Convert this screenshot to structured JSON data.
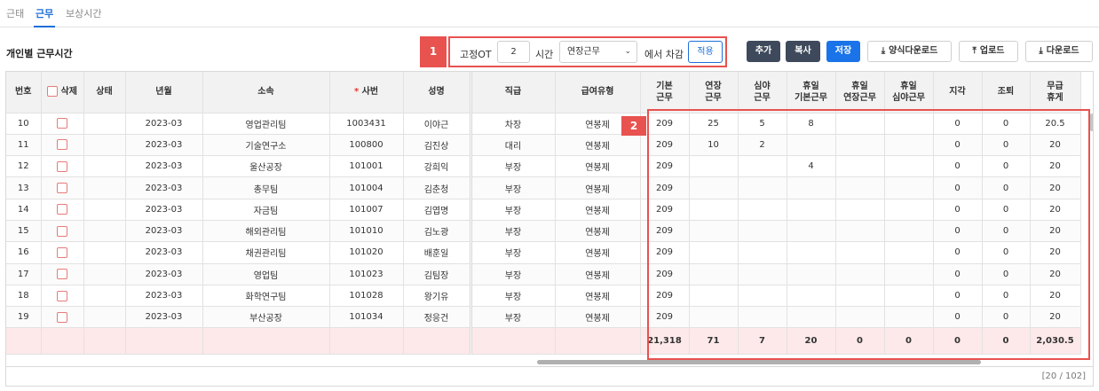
{
  "tabs": [
    {
      "label": "근태",
      "active": false
    },
    {
      "label": "근무",
      "active": true
    },
    {
      "label": "보상시간",
      "active": false
    }
  ],
  "page_title": "개인별 근무시간",
  "ot_control": {
    "marker": "1",
    "label_fixed": "고정OT",
    "value": "2",
    "label_hours": "시간",
    "select_value": "연장근무",
    "label_deduct": "에서 차감",
    "apply_label": "적용"
  },
  "toolbar": {
    "add_label": "추가",
    "copy_label": "복사",
    "save_label": "저장",
    "template_download_label": "양식다운로드",
    "upload_label": "업로드",
    "download_label": "다운로드"
  },
  "grid": {
    "highlight_marker": "2",
    "headers": {
      "no": "번호",
      "delete": "삭제",
      "status": "상태",
      "year_month": "년월",
      "department": "소속",
      "emp_no": "사번",
      "name": "성명",
      "rank": "직급",
      "pay_type": "급여유형",
      "base_work": "기본\n근무",
      "overtime": "연장\n근무",
      "night": "심야\n근무",
      "holiday_base": "휴일\n기본근무",
      "holiday_overtime": "휴일\n연장근무",
      "holiday_night": "휴일\n심야근무",
      "late": "지각",
      "early_leave": "조퇴",
      "unpaid_leave": "무급\n휴게"
    },
    "rows": [
      {
        "no": "10",
        "status": "",
        "ym": "2023-03",
        "dept": "영업관리팀",
        "emp": "1003431",
        "name": "이야근",
        "rank": "차장",
        "pay": "연봉제",
        "base": "209",
        "ot": "25",
        "night": "5",
        "hbase": "8",
        "hot": "",
        "hnight": "",
        "late": "0",
        "early": "0",
        "unpaid": "20.5"
      },
      {
        "no": "11",
        "status": "",
        "ym": "2023-03",
        "dept": "기술연구소",
        "emp": "100800",
        "name": "김진상",
        "rank": "대리",
        "pay": "연봉제",
        "base": "209",
        "ot": "10",
        "night": "2",
        "hbase": "",
        "hot": "",
        "hnight": "",
        "late": "0",
        "early": "0",
        "unpaid": "20"
      },
      {
        "no": "12",
        "status": "",
        "ym": "2023-03",
        "dept": "울산공장",
        "emp": "101001",
        "name": "강희익",
        "rank": "부장",
        "pay": "연봉제",
        "base": "209",
        "ot": "",
        "night": "",
        "hbase": "4",
        "hot": "",
        "hnight": "",
        "late": "0",
        "early": "0",
        "unpaid": "20"
      },
      {
        "no": "13",
        "status": "",
        "ym": "2023-03",
        "dept": "총무팀",
        "emp": "101004",
        "name": "김춘청",
        "rank": "부장",
        "pay": "연봉제",
        "base": "209",
        "ot": "",
        "night": "",
        "hbase": "",
        "hot": "",
        "hnight": "",
        "late": "0",
        "early": "0",
        "unpaid": "20"
      },
      {
        "no": "14",
        "status": "",
        "ym": "2023-03",
        "dept": "자금팀",
        "emp": "101007",
        "name": "김엽명",
        "rank": "부장",
        "pay": "연봉제",
        "base": "209",
        "ot": "",
        "night": "",
        "hbase": "",
        "hot": "",
        "hnight": "",
        "late": "0",
        "early": "0",
        "unpaid": "20"
      },
      {
        "no": "15",
        "status": "",
        "ym": "2023-03",
        "dept": "해외관리팀",
        "emp": "101010",
        "name": "김노광",
        "rank": "부장",
        "pay": "연봉제",
        "base": "209",
        "ot": "",
        "night": "",
        "hbase": "",
        "hot": "",
        "hnight": "",
        "late": "0",
        "early": "0",
        "unpaid": "20"
      },
      {
        "no": "16",
        "status": "",
        "ym": "2023-03",
        "dept": "채권관리팀",
        "emp": "101020",
        "name": "배훈일",
        "rank": "부장",
        "pay": "연봉제",
        "base": "209",
        "ot": "",
        "night": "",
        "hbase": "",
        "hot": "",
        "hnight": "",
        "late": "0",
        "early": "0",
        "unpaid": "20"
      },
      {
        "no": "17",
        "status": "",
        "ym": "2023-03",
        "dept": "영업팀",
        "emp": "101023",
        "name": "김팀장",
        "rank": "부장",
        "pay": "연봉제",
        "base": "209",
        "ot": "",
        "night": "",
        "hbase": "",
        "hot": "",
        "hnight": "",
        "late": "0",
        "early": "0",
        "unpaid": "20"
      },
      {
        "no": "18",
        "status": "",
        "ym": "2023-03",
        "dept": "화학연구팀",
        "emp": "101028",
        "name": "왕기유",
        "rank": "부장",
        "pay": "연봉제",
        "base": "209",
        "ot": "",
        "night": "",
        "hbase": "",
        "hot": "",
        "hnight": "",
        "late": "0",
        "early": "0",
        "unpaid": "20"
      },
      {
        "no": "19",
        "status": "",
        "ym": "2023-03",
        "dept": "부산공장",
        "emp": "101034",
        "name": "정응건",
        "rank": "부장",
        "pay": "연봉제",
        "base": "209",
        "ot": "",
        "night": "",
        "hbase": "",
        "hot": "",
        "hnight": "",
        "late": "0",
        "early": "0",
        "unpaid": "20"
      }
    ],
    "totals": {
      "base": "21,318",
      "ot": "71",
      "night": "7",
      "hbase": "20",
      "hot": "0",
      "hnight": "0",
      "late": "0",
      "early": "0",
      "unpaid": "2,030.5"
    },
    "record_count": "[20 / 102]"
  },
  "colors": {
    "accent": "#1e6fd9",
    "highlight": "#e8524f",
    "dark_button": "#3e4a5c"
  }
}
